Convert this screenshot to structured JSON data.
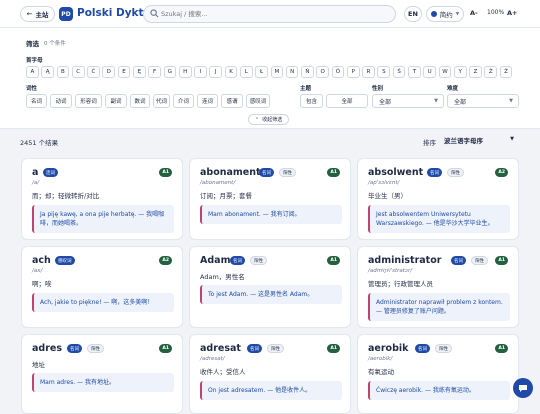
{
  "header": {
    "home_label": "主站",
    "logo_text": "PD",
    "brand": "Polski Dykt",
    "search_placeholder": "Szukaj / 搜索...",
    "lang_label": "EN",
    "theme_label": "简约",
    "font_small": "A-",
    "zoom": "100%",
    "font_large": "A+"
  },
  "filters": {
    "title": "筛选",
    "count": "0 个条件",
    "initial_label": "首字母",
    "letters": [
      "A",
      "Ą",
      "B",
      "C",
      "Ć",
      "D",
      "E",
      "Ę",
      "F",
      "G",
      "H",
      "I",
      "J",
      "K",
      "L",
      "Ł",
      "M",
      "N",
      "Ń",
      "O",
      "Ó",
      "P",
      "R",
      "S",
      "Ś",
      "T",
      "U",
      "W",
      "Y",
      "Z",
      "Ź",
      "Ż"
    ],
    "pos_label": "词性",
    "pos_options": [
      "名词",
      "动词",
      "形容词",
      "副词",
      "数词",
      "代词",
      "介词",
      "连词",
      "感谓",
      "感叹词"
    ],
    "topic_label": "主题",
    "topic_chips": [
      "包含",
      "全部"
    ],
    "gender_label": "性别",
    "gender_value": "全部",
    "level_label": "难度",
    "level_value": "全部",
    "collapse_label": "收起筛选"
  },
  "results": {
    "count": "2451 个结果",
    "sort_label": "排序",
    "sort_value": "波兰语字母序"
  },
  "cards": [
    {
      "word": "a",
      "pos": "连词",
      "gender": "",
      "level": "A1",
      "ipa": "/a/",
      "translation": "而；却；轻微转折/对比",
      "example": "Ja piję kawę, a ona pije herbatę. — 我喝咖啡，而她喝茶。"
    },
    {
      "word": "abonament",
      "pos": "名词",
      "gender": "阳性",
      "level": "A1",
      "ipa": "/abonament/",
      "translation": "订阅；月票；套餐",
      "example": "Mam abonament. — 我有订阅。"
    },
    {
      "word": "absolwent",
      "pos": "名词",
      "gender": "阳性",
      "level": "A2",
      "ipa": "/ap'sɔlvɛnt/",
      "translation": "毕业生（男）",
      "example": "Jest absolwentem Uniwersytetu Warszawskiego. — 他是华沙大学毕业生。"
    },
    {
      "word": "ach",
      "pos": "感叹词",
      "gender": "",
      "level": "A2",
      "ipa": "/ax/",
      "translation": "啊；唉",
      "example": "Ach, jakie to piękne! — 啊，这多美啊！"
    },
    {
      "word": "Adam",
      "pos": "名词",
      "gender": "阳性",
      "level": "A1",
      "ipa": "",
      "translation": "Adam，男性名",
      "example": "To jest Adam. — 这是男性名 Adam。"
    },
    {
      "word": "administrator",
      "pos": "名词",
      "gender": "阳性",
      "level": "A1",
      "ipa": "/admʲiɲʲi'stratɔr/",
      "translation": "管理员；行政管理人员",
      "example": "Administrator naprawił problem z kontem. — 管理员修复了账户问题。"
    },
    {
      "word": "adres",
      "pos": "名词",
      "gender": "阳性",
      "level": "A1",
      "ipa": "",
      "translation": "地址",
      "example": "Mam adres. — 我有地址。"
    },
    {
      "word": "adresat",
      "pos": "名词",
      "gender": "阳性",
      "level": "A1",
      "ipa": "/adresat/",
      "translation": "收件人；受信人",
      "example": "On jest adresatem. — 他是收件人。"
    },
    {
      "word": "aerobik",
      "pos": "名词",
      "gender": "阳性",
      "level": "A1",
      "ipa": "/aerobik/",
      "translation": "有氧运动",
      "example": "Ćwiczę aerobik. — 我练有氧运动。"
    }
  ]
}
